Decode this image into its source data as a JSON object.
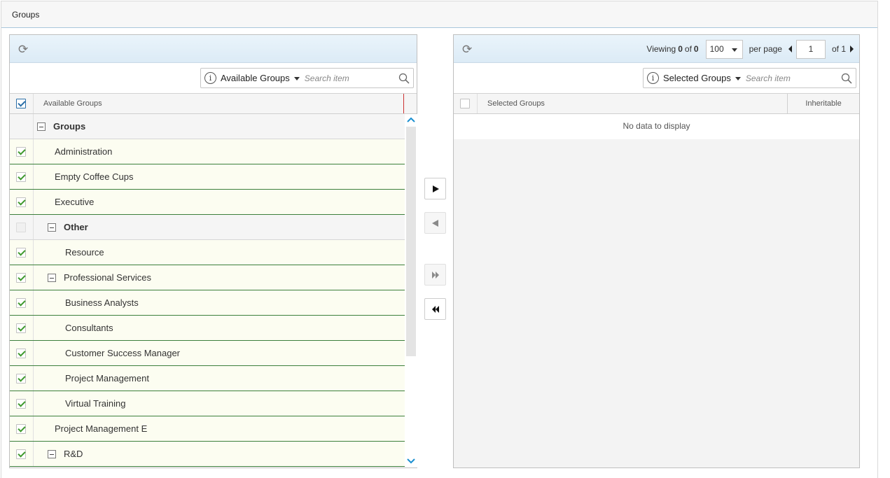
{
  "header": {
    "title": "Groups"
  },
  "left_panel": {
    "scope_label": "Available Groups",
    "search_placeholder": "Search item",
    "column_title": "Available Groups",
    "rows": [
      {
        "label": "Groups",
        "checked": false,
        "kind": "group",
        "indent": 0,
        "toggle": true,
        "no_checkbox": true
      },
      {
        "label": "Administration",
        "checked": true,
        "kind": "item",
        "indent": 1
      },
      {
        "label": "Empty Coffee Cups",
        "checked": true,
        "kind": "item",
        "indent": 1
      },
      {
        "label": "Executive",
        "checked": true,
        "kind": "item",
        "indent": 1
      },
      {
        "label": "Other",
        "checked": false,
        "kind": "group",
        "indent": 1,
        "toggle": true,
        "disabled": true
      },
      {
        "label": "Resource",
        "checked": true,
        "kind": "item",
        "indent": 2
      },
      {
        "label": "Professional Services",
        "checked": true,
        "kind": "item",
        "indent": 1,
        "toggle": true
      },
      {
        "label": "Business Analysts",
        "checked": true,
        "kind": "item",
        "indent": 2
      },
      {
        "label": "Consultants",
        "checked": true,
        "kind": "item",
        "indent": 2
      },
      {
        "label": "Customer Success Manager",
        "checked": true,
        "kind": "item",
        "indent": 2
      },
      {
        "label": "Project Management",
        "checked": true,
        "kind": "item",
        "indent": 2
      },
      {
        "label": "Virtual Training",
        "checked": true,
        "kind": "item",
        "indent": 2
      },
      {
        "label": "Project Management E",
        "checked": true,
        "kind": "item",
        "indent": 1
      },
      {
        "label": "R&D",
        "checked": true,
        "kind": "item",
        "indent": 1,
        "toggle": true
      }
    ]
  },
  "right_panel": {
    "pager": {
      "viewing_label": "Viewing",
      "viewing_from": "0",
      "of_label": "of",
      "viewing_total": "0",
      "per_page_value": "100",
      "per_page_label": "per page",
      "page_value": "1",
      "of_pages": "of 1"
    },
    "scope_label": "Selected Groups",
    "search_placeholder": "Search item",
    "column_title": "Selected Groups",
    "inherit_column": "Inheritable",
    "empty_text": "No data to display"
  },
  "colors": {
    "row_border": "#3c7f3c",
    "row_bg": "#fcfdf1",
    "toolbar_bg": "#dcebf6",
    "check": "#3f9a2e",
    "scroll_arrow": "#1a8fd0"
  }
}
